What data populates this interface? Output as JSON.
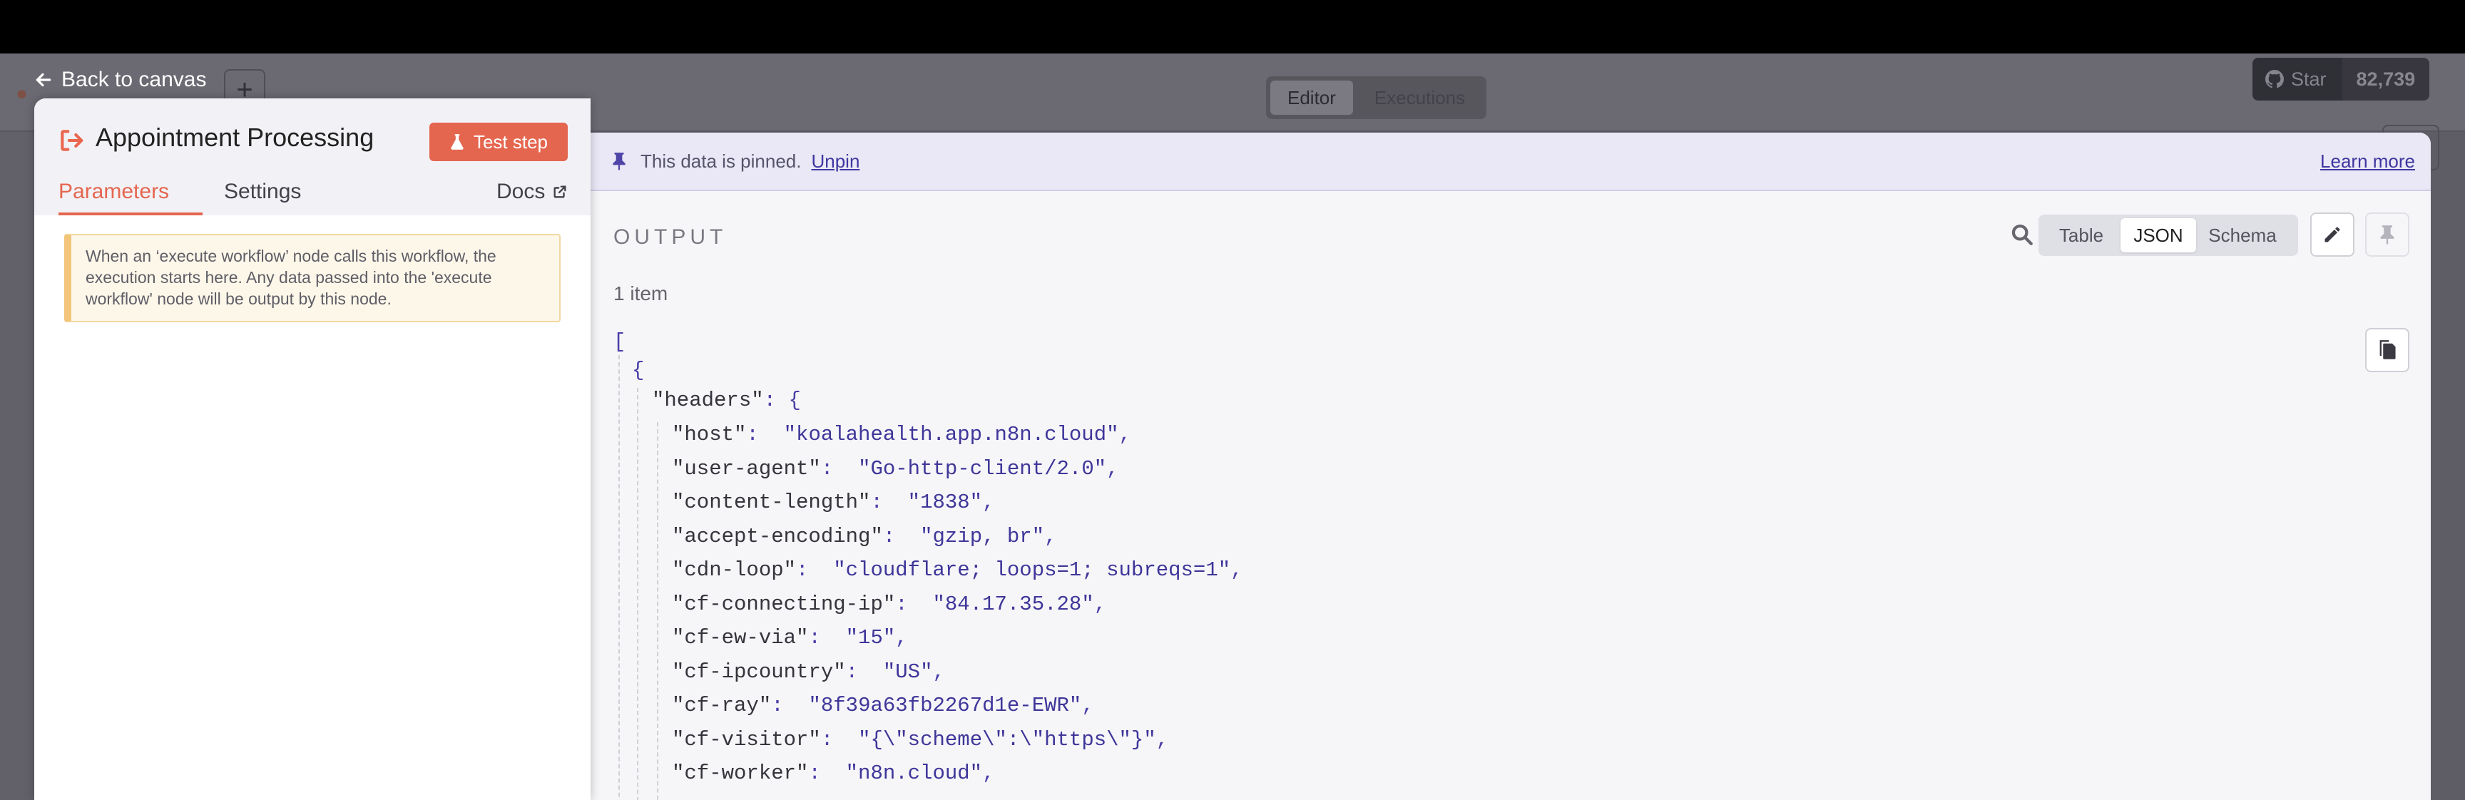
{
  "canvas": {
    "back_label": "Back to canvas",
    "tabs": [
      {
        "label": "Editor"
      },
      {
        "label": "Executions"
      }
    ],
    "add_label": "+",
    "github": {
      "star_label": "Star",
      "count": "82,739"
    }
  },
  "node": {
    "title": "Appointment Processing",
    "test_button": "Test step",
    "tabs": {
      "parameters": "Parameters",
      "settings": "Settings",
      "docs": "Docs"
    },
    "notice": "When an ‘execute workflow’ node calls this workflow, the execution starts here. Any data passed into the 'execute workflow' node will be output by this node."
  },
  "output": {
    "banner": {
      "text": "This data is pinned.",
      "unpin": "Unpin",
      "learn_more": "Learn more"
    },
    "label": "OUTPUT",
    "views": {
      "table": "Table",
      "json": "JSON",
      "schema": "Schema"
    },
    "item_count": "1 item",
    "json_open_bracket": "[",
    "json_open_brace": "{",
    "headers_key": "\"headers\"",
    "headers": [
      {
        "key": "\"host\"",
        "value": "\"koalahealth.app.n8n.cloud\""
      },
      {
        "key": "\"user-agent\"",
        "value": "\"Go-http-client/2.0\""
      },
      {
        "key": "\"content-length\"",
        "value": "\"1838\""
      },
      {
        "key": "\"accept-encoding\"",
        "value": "\"gzip, br\""
      },
      {
        "key": "\"cdn-loop\"",
        "value": "\"cloudflare; loops=1; subreqs=1\""
      },
      {
        "key": "\"cf-connecting-ip\"",
        "value": "\"84.17.35.28\""
      },
      {
        "key": "\"cf-ew-via\"",
        "value": "\"15\""
      },
      {
        "key": "\"cf-ipcountry\"",
        "value": "\"US\""
      },
      {
        "key": "\"cf-ray\"",
        "value": "\"8f39a63fb2267d1e-EWR\""
      },
      {
        "key": "\"cf-visitor\"",
        "value": "\"{\\\"scheme\\\":\\\"https\\\"}\""
      },
      {
        "key": "\"cf-worker\"",
        "value": "\"n8n.cloud\""
      }
    ]
  },
  "colors": {
    "accent": "#e5664f",
    "pinned_banner": "#eae8f6",
    "link": "#3f36a0"
  }
}
